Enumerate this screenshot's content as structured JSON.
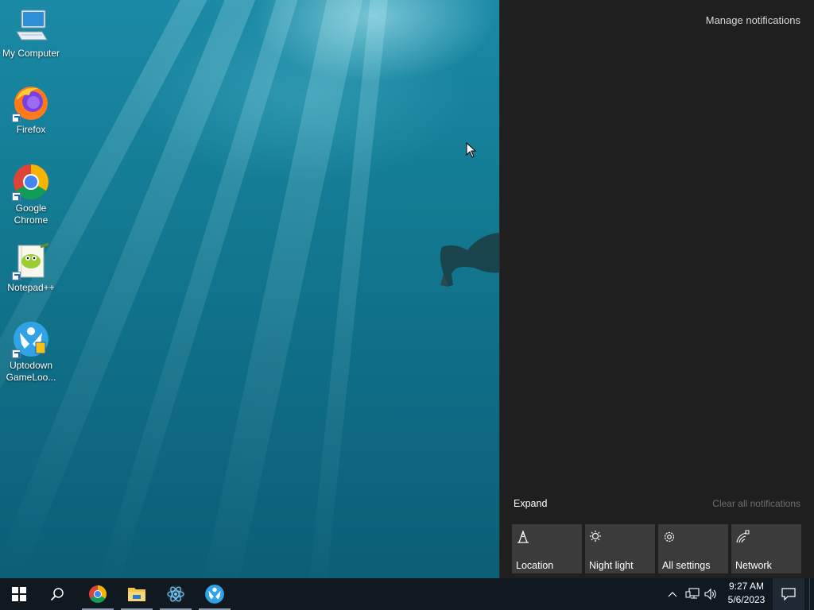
{
  "desktop": {
    "icons": [
      {
        "label": "My Computer",
        "icon": "computer-icon"
      },
      {
        "label": "Firefox",
        "icon": "firefox-icon"
      },
      {
        "label": "Google Chrome",
        "icon": "chrome-icon"
      },
      {
        "label": "Notepad++",
        "icon": "notepadpp-icon"
      },
      {
        "label": "Uptodown GameLoo...",
        "icon": "gameloop-icon"
      }
    ]
  },
  "action_center": {
    "manage_notifications": "Manage notifications",
    "expand_label": "Expand",
    "clear_all_label": "Clear all notifications",
    "quick_actions": [
      {
        "label": "Location",
        "icon": "location-icon"
      },
      {
        "label": "Night light",
        "icon": "night-light-icon"
      },
      {
        "label": "All settings",
        "icon": "settings-gear-icon"
      },
      {
        "label": "Network",
        "icon": "network-icon"
      }
    ]
  },
  "taskbar": {
    "start": "start-icon",
    "search": "search-icon",
    "pinned": [
      {
        "name": "Google Chrome",
        "icon": "chrome-icon"
      },
      {
        "name": "File Explorer",
        "icon": "file-explorer-icon"
      },
      {
        "name": "Electron",
        "icon": "electron-icon"
      },
      {
        "name": "Uptodown GameLoop",
        "icon": "gameloop-icon"
      }
    ],
    "tray": {
      "time": "9:27 AM",
      "date": "5/6/2023"
    }
  },
  "colors": {
    "action_center_bg": "#1f1f1f",
    "tile_bg": "#3b3b3b",
    "taskbar_bg": "#101820",
    "wallpaper": "#137b93"
  }
}
